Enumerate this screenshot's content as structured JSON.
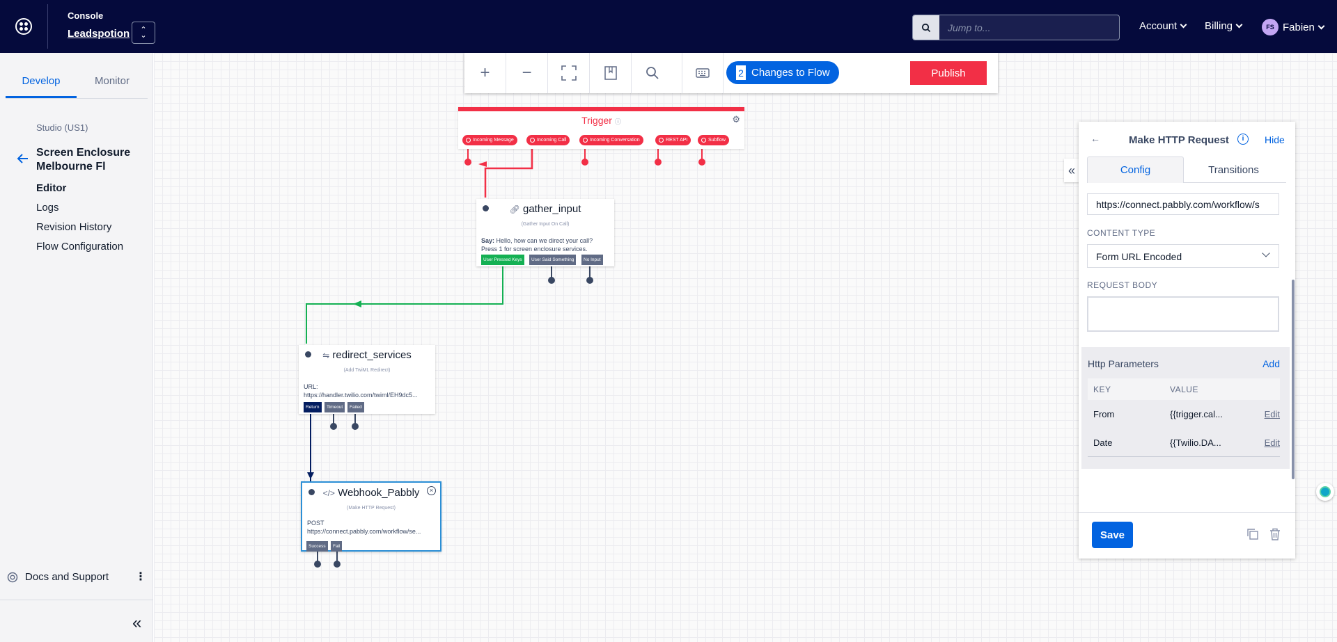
{
  "topbar": {
    "console_label": "Console",
    "account_name": "Leadspotion",
    "search_placeholder": "Jump to...",
    "menus": {
      "account": "Account",
      "billing": "Billing",
      "user": "Fabien"
    },
    "user_initials": "FS"
  },
  "sidebar": {
    "tabs": [
      "Develop",
      "Monitor"
    ],
    "studio_label": "Studio (US1)",
    "flow_title": "Screen Enclosure Melbourne Fl",
    "nav": [
      "Editor",
      "Logs",
      "Revision History",
      "Flow Configuration"
    ],
    "docs_label": "Docs and Support"
  },
  "toolbar": {
    "changes_count": "2",
    "changes_label": "Changes to Flow",
    "publish_label": "Publish"
  },
  "trigger": {
    "title": "Trigger",
    "pills": [
      "Incoming Message",
      "Incoming Call",
      "Incoming Conversation",
      "REST API",
      "Subflow"
    ]
  },
  "widgets": {
    "gather": {
      "name": "gather_input",
      "subtitle": "(Gather Input On Call)",
      "body_label": "Say:",
      "body_text": "Hello, how can we direct your call?",
      "body_line2": "Press 1 for screen enclosure services.",
      "transitions": [
        "User Pressed Keys",
        "User Said Something",
        "No Input"
      ]
    },
    "redirect": {
      "name": "redirect_services",
      "subtitle": "(Add TwiML Redirect)",
      "body_label": "URL:",
      "body_text": "https://handler.twilio.com/twiml/EH9dc5...",
      "transitions": [
        "Return",
        "Timeout",
        "Failed"
      ]
    },
    "webhook": {
      "name": "Webhook_Pabbly",
      "subtitle": "(Make HTTP Request)",
      "body_label": "POST",
      "body_text": "https://connect.pabbly.com/workflow/se...",
      "transitions": [
        "Success",
        "Fail"
      ]
    }
  },
  "panel": {
    "title": "Make HTTP Request",
    "hide_label": "Hide",
    "tabs": [
      "Config",
      "Transitions"
    ],
    "url_value": "https://connect.pabbly.com/workflow/s",
    "content_type_label": "CONTENT TYPE",
    "content_type_value": "Form URL Encoded",
    "request_body_label": "REQUEST BODY",
    "http_params_title": "Http Parameters",
    "add_label": "Add",
    "table_headers": [
      "KEY",
      "VALUE"
    ],
    "params": [
      {
        "key": "From",
        "value": "{{trigger.cal...",
        "edit": "Edit"
      },
      {
        "key": "Date",
        "value": "{{Twilio.DA...",
        "edit": "Edit"
      }
    ],
    "save_label": "Save"
  },
  "colors": {
    "topbar": "#050a3c",
    "brand_red": "#f22f46",
    "primary_blue": "#0263e0",
    "green": "#14b053"
  }
}
